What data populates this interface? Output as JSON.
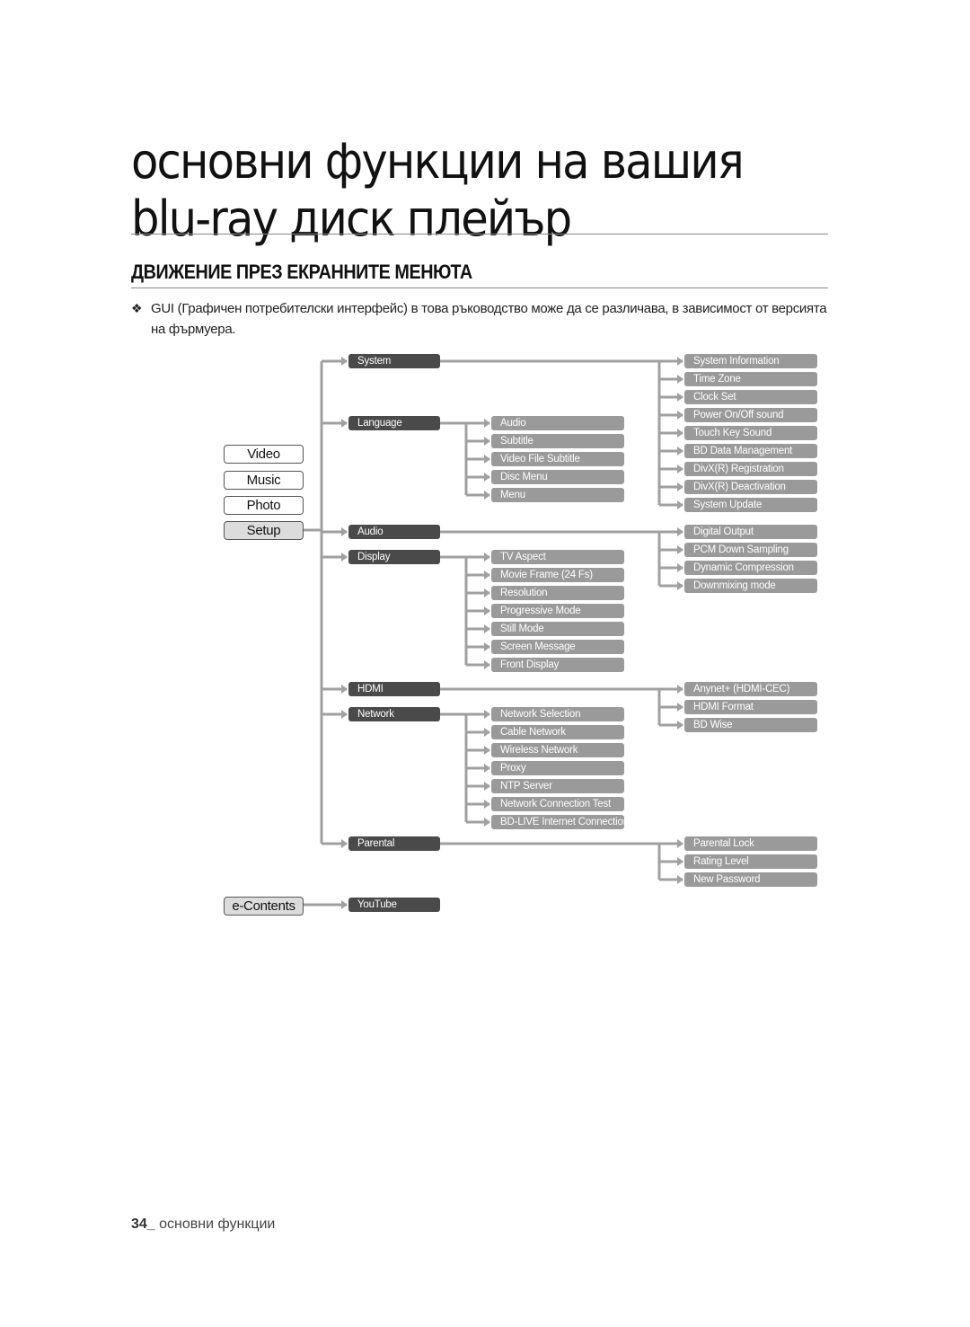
{
  "page": {
    "title_line1": "основни функции на вашия",
    "title_line2": "blu-ray диск плейър",
    "section_heading": "ДВИЖЕНИЕ ПРЕЗ ЕКРАННИТЕ МЕНЮТА",
    "note_bullet": "❖",
    "note_text": "GUI (Графичен потребителски интерфейс) в това ръководство може да се различава, в зависимост от версията на фърмуера.",
    "footer_page_number": "34_",
    "footer_label": "основни функции"
  },
  "colors": {
    "level1_box": "#4a4a4a",
    "level2_box": "#9a9a9a",
    "connector": "#a0a0a0",
    "active_main": "#dcdcdc"
  },
  "main_menu": [
    {
      "label": "Video",
      "active": false
    },
    {
      "label": "Music",
      "active": false
    },
    {
      "label": "Photo",
      "active": false
    },
    {
      "label": "Setup",
      "active": true
    },
    {
      "label": "e-Contents",
      "active": true
    }
  ],
  "setup_tree": [
    {
      "label": "System",
      "children_side": "right",
      "children": [
        "System Information",
        "Time Zone",
        "Clock Set",
        "Power On/Off sound",
        "Touch Key Sound",
        "BD Data Management",
        "DivX(R) Registration",
        "DivX(R) Deactivation",
        "System Update"
      ]
    },
    {
      "label": "Language",
      "children_side": "middle",
      "children": [
        "Audio",
        "Subtitle",
        "Video File Subtitle",
        "Disc Menu",
        "Menu"
      ]
    },
    {
      "label": "Audio",
      "children_side": "right",
      "children": [
        "Digital Output",
        "PCM Down Sampling",
        "Dynamic Compression",
        "Downmixing mode"
      ]
    },
    {
      "label": "Display",
      "children_side": "middle",
      "children": [
        "TV Aspect",
        "Movie Frame (24 Fs)",
        "Resolution",
        "Progressive Mode",
        "Still Mode",
        "Screen Message",
        "Front Display"
      ]
    },
    {
      "label": "HDMI",
      "children_side": "right",
      "children": [
        "Anynet+ (HDMI-CEC)",
        "HDMI Format",
        "BD Wise"
      ]
    },
    {
      "label": "Network",
      "children_side": "middle",
      "children": [
        "Network Selection",
        "Cable Network",
        "Wireless Network",
        "Proxy",
        "NTP Server",
        "Network Connection Test",
        "BD-LIVE Internet Connection"
      ]
    },
    {
      "label": "Parental",
      "children_side": "right",
      "children": [
        "Parental Lock",
        "Rating Level",
        "New Password"
      ]
    }
  ],
  "econtents_tree": [
    {
      "label": "YouTube"
    }
  ]
}
